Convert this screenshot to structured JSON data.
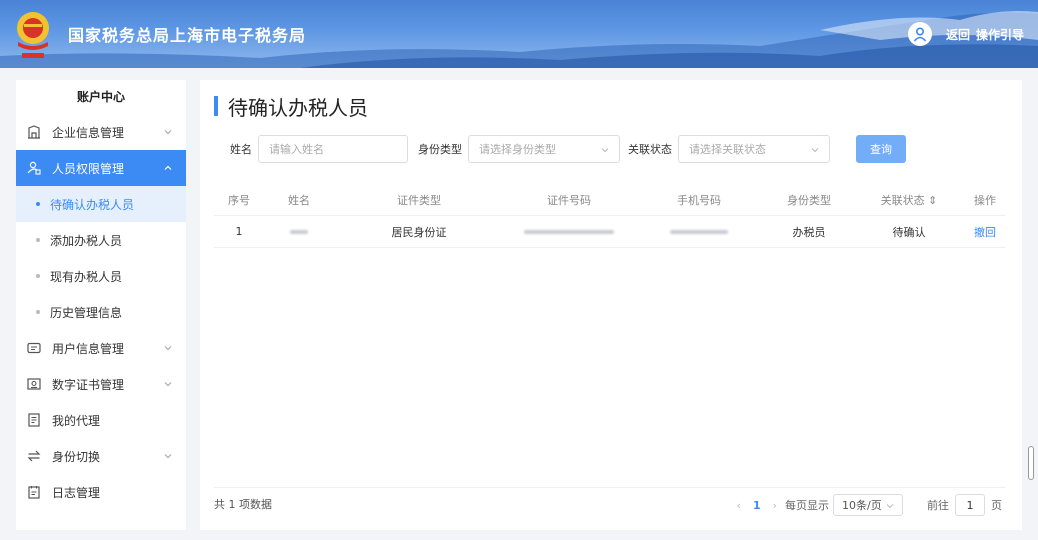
{
  "header": {
    "site_title": "国家税务总局上海市电子税务局",
    "links": [
      "返回",
      "操作引导"
    ],
    "colors": {
      "header": "#5b95e3",
      "accent": "#3c8af3"
    }
  },
  "sidebar": {
    "title": "账户中心",
    "items": [
      {
        "label": "企业信息管理",
        "icon": "building-icon",
        "expandable": true,
        "active": false
      },
      {
        "label": "人员权限管理",
        "icon": "user-lock-icon",
        "expandable": true,
        "active": true,
        "children": [
          {
            "label": "待确认办税人员",
            "active": true
          },
          {
            "label": "添加办税人员",
            "active": false
          },
          {
            "label": "现有办税人员",
            "active": false
          },
          {
            "label": "历史管理信息",
            "active": false
          }
        ]
      },
      {
        "label": "用户信息管理",
        "icon": "id-card-icon",
        "expandable": true,
        "active": false
      },
      {
        "label": "数字证书管理",
        "icon": "certificate-icon",
        "expandable": true,
        "active": false
      },
      {
        "label": "我的代理",
        "icon": "document-icon",
        "expandable": false,
        "active": false
      },
      {
        "label": "身份切换",
        "icon": "switch-icon",
        "expandable": true,
        "active": false
      },
      {
        "label": "日志管理",
        "icon": "log-icon",
        "expandable": false,
        "active": false
      }
    ]
  },
  "main": {
    "title": "待确认办税人员",
    "filters": {
      "name_label": "姓名",
      "name_placeholder": "请输入姓名",
      "idtype_label": "身份类型",
      "idtype_placeholder": "请选择身份类型",
      "status_label": "关联状态",
      "status_placeholder": "请选择关联状态",
      "query_label": "查询"
    },
    "table": {
      "headers": [
        "序号",
        "姓名",
        "证件类型",
        "证件号码",
        "手机号码",
        "身份类型",
        "关联状态 ⇕",
        "操作"
      ],
      "rows": [
        {
          "index": "1",
          "cert_type": "居民身份证",
          "id_type": "办税员",
          "status": "待确认",
          "action": "撤回"
        }
      ]
    },
    "footer": {
      "total": "共 1 项数据",
      "prev": "‹",
      "current_page": "1",
      "next": "›",
      "per_page_label": "每页显示",
      "per_page_value": "10条/页",
      "goto_label": "前往",
      "goto_value": "1",
      "page_unit": "页"
    }
  }
}
